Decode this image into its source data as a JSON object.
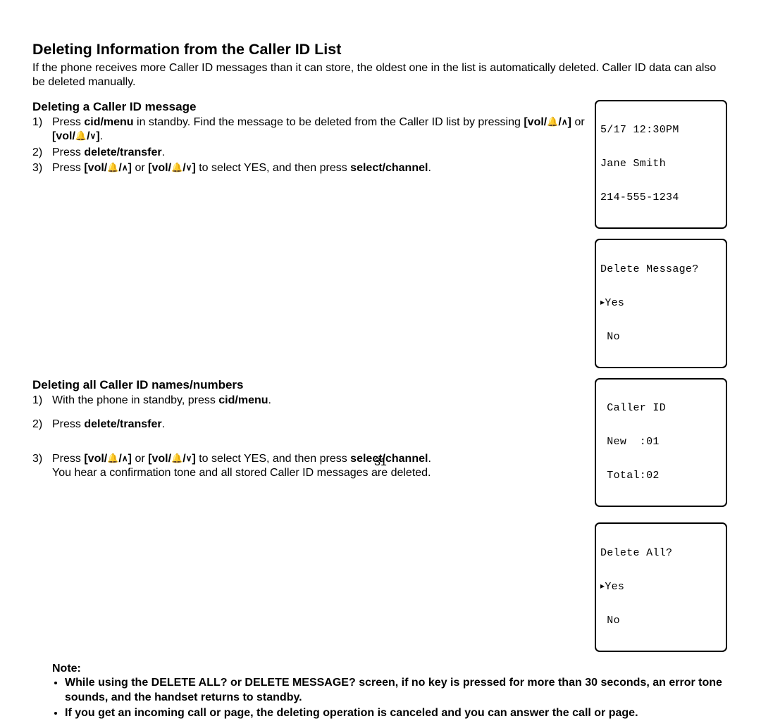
{
  "title": "Deleting Information from the Caller ID List",
  "intro": "If the phone receives more Caller ID messages than it can store, the oldest one in the list is automatically deleted. Caller ID data can also be deleted manually.",
  "sectionA": {
    "heading": "Deleting a Caller ID message",
    "step1_a": "Press ",
    "step1_b": "cid/menu",
    "step1_c": " in standby. Find the message to be deleted from the Caller ID list by pressing ",
    "step1_or": " or ",
    "step1_end": ".",
    "step2_a": "Press ",
    "step2_b": "delete/transfer",
    "step2_c": ".",
    "step3_a": "Press ",
    "step3_or": " or ",
    "step3_mid": " to select YES, and then press ",
    "step3_b": "select/channel",
    "step3_c": "."
  },
  "sectionB": {
    "heading": "Deleting all Caller ID names/numbers",
    "step1_a": "With the phone in standby, press ",
    "step1_b": "cid/menu",
    "step1_c": ".",
    "step2_a": "Press ",
    "step2_b": "delete/transfer",
    "step2_c": ".",
    "step3_a": "Press ",
    "step3_or": " or ",
    "step3_mid": " to select YES, and then press ",
    "step3_b": "select/channel",
    "step3_c": ".",
    "step3_tail": "You hear a confirmation tone and all stored Caller ID messages are deleted."
  },
  "note": {
    "label": "Note:",
    "b1": "While using the DELETE ALL? or DELETE MESSAGE? screen, if no key is pressed for more than 30 seconds, an error tone sounds, and the handset returns to standby.",
    "b2": "If you get an incoming call or page, the deleting operation is canceled and you can answer the call or page."
  },
  "vol": {
    "prefix": "[vol/",
    "sep": "/",
    "suffix": "]"
  },
  "lcd1": {
    "l1": "5/17 12:30PM",
    "l2": "Jane Smith",
    "l3": "214-555-1234"
  },
  "lcd2": {
    "l1": "Delete Message?",
    "l2_yes": "Yes",
    "l3": " No"
  },
  "lcd3": {
    "l1": " Caller ID",
    "l2": " New  :01",
    "l3": " Total:02"
  },
  "lcd4": {
    "l1": "Delete All?",
    "l2_yes": "Yes",
    "l3": " No"
  },
  "page_number": "31"
}
